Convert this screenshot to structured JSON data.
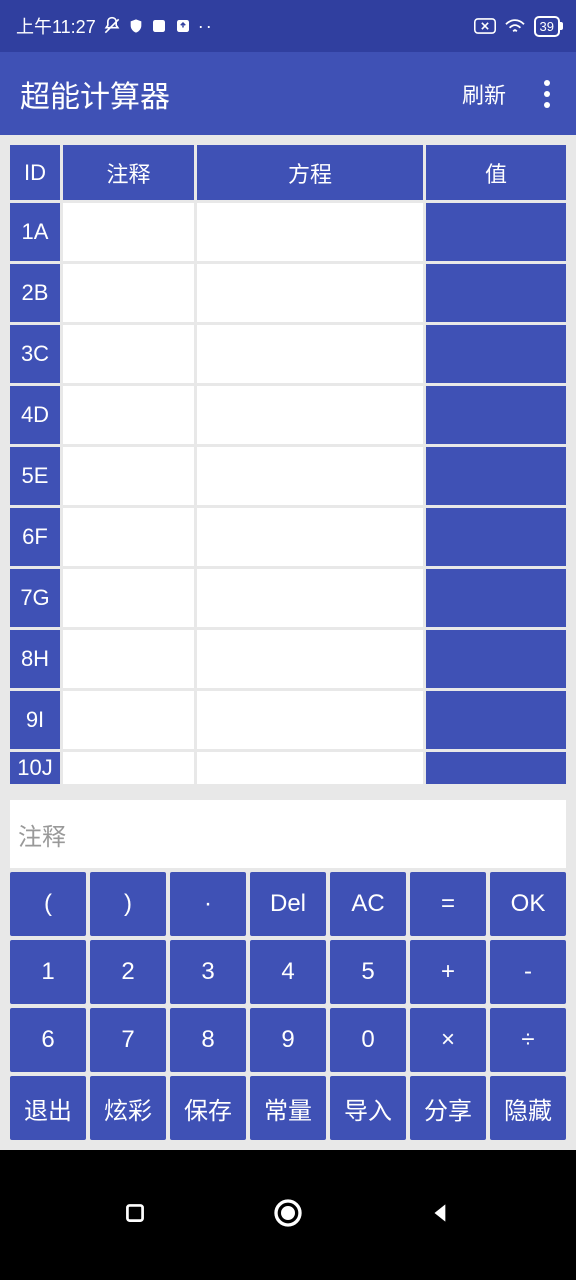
{
  "status": {
    "time": "上午11:27",
    "battery": "39"
  },
  "app": {
    "title": "超能计算器",
    "refresh": "刷新"
  },
  "table": {
    "headers": {
      "id": "ID",
      "note": "注释",
      "equation": "方程",
      "value": "值"
    },
    "rows": [
      {
        "id": "1A",
        "note": "",
        "eq": "",
        "val": ""
      },
      {
        "id": "2B",
        "note": "",
        "eq": "",
        "val": ""
      },
      {
        "id": "3C",
        "note": "",
        "eq": "",
        "val": ""
      },
      {
        "id": "4D",
        "note": "",
        "eq": "",
        "val": ""
      },
      {
        "id": "5E",
        "note": "",
        "eq": "",
        "val": ""
      },
      {
        "id": "6F",
        "note": "",
        "eq": "",
        "val": ""
      },
      {
        "id": "7G",
        "note": "",
        "eq": "",
        "val": ""
      },
      {
        "id": "8H",
        "note": "",
        "eq": "",
        "val": ""
      },
      {
        "id": "9I",
        "note": "",
        "eq": "",
        "val": ""
      },
      {
        "id": "10J",
        "note": "",
        "eq": "",
        "val": ""
      }
    ]
  },
  "input": {
    "placeholder": "注释"
  },
  "keys": {
    "r1": [
      "(",
      ")",
      "·",
      "Del",
      "AC",
      "=",
      "OK"
    ],
    "r2": [
      "1",
      "2",
      "3",
      "4",
      "5",
      "+",
      "-"
    ],
    "r3": [
      "6",
      "7",
      "8",
      "9",
      "0",
      "×",
      "÷"
    ],
    "r4": [
      "退出",
      "炫彩",
      "保存",
      "常量",
      "导入",
      "分享",
      "隐藏"
    ]
  }
}
